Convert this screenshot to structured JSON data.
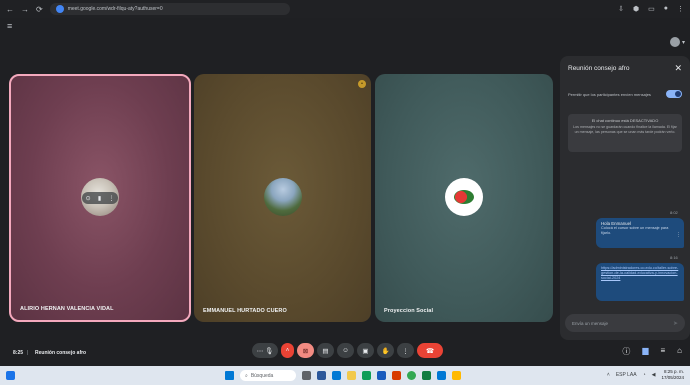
{
  "browser": {
    "url": "meet.google.com/wdr-filqu-aty?authuser=0",
    "back_icon": "arrow-left",
    "forward_icon": "arrow-right",
    "reload_icon": "reload"
  },
  "tiles": [
    {
      "name": "ALIRIO HERNAN VALENCIA VIDAL",
      "bg": "#6e3e50",
      "border": "#f4a9bd"
    },
    {
      "name": "EMMANUEL HURTADO CUERO",
      "bg": "#5a4a2d"
    },
    {
      "name": "Proyeccion Social",
      "bg": "#405a5a"
    }
  ],
  "chat": {
    "title": "Reunión consejo afro",
    "toggle_label": "Permitir que los participantes envíen mensajes",
    "info_title": "El chat continuo está DESACTIVADO",
    "info_body": "Los mensajes no se guardarán cuando finalice la llamada. El fijar un mensaje, las personas que se unan más tarde podrán verlo.",
    "messages": [
      {
        "time": "8:02",
        "title": "Hola Enmanuel",
        "text": "Colocá el cursor sobre un mensaje para fijarlo."
      },
      {
        "time": "8:16",
        "link": "https://administradores.co.edu.co/taller-sobre-gestion-de-la-calidad-educativa-y-innovacion-social-2024"
      }
    ],
    "input_placeholder": "Envía un mensaje"
  },
  "meeting": {
    "time": "8:25",
    "separator": "|",
    "name": "Reunión consejo afro"
  },
  "taskbar": {
    "search_label": "Búsqueda",
    "clock_time": "8:25 p. m.",
    "clock_date": "17/05/2024",
    "lang": "ESP\nLAA"
  },
  "colors": {
    "accent": "#8ab4f8",
    "hangup": "#ea4335",
    "panel": "#2b2c2f",
    "bubble": "#1e4b7c"
  }
}
